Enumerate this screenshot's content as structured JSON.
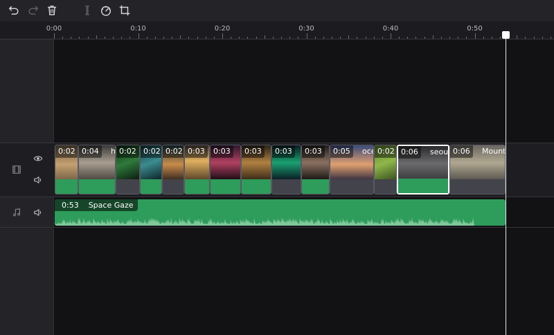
{
  "toolbar": {
    "tools": [
      {
        "name": "undo-icon",
        "enabled": true
      },
      {
        "name": "redo-icon",
        "enabled": false
      },
      {
        "name": "delete-icon",
        "enabled": true
      },
      {
        "name": "split-icon",
        "enabled": false
      },
      {
        "name": "speed-icon",
        "enabled": true
      },
      {
        "name": "crop-icon",
        "enabled": true
      }
    ]
  },
  "ruler": {
    "labels": [
      "0:00",
      "0:10",
      "0:20",
      "0:30",
      "0:40",
      "0:50"
    ]
  },
  "video_track": {
    "icons": [
      "film-icon",
      "eye-icon",
      "volume-icon"
    ],
    "clips": [
      {
        "dur": "0:02",
        "name": ""
      },
      {
        "dur": "0:04",
        "name": "h"
      },
      {
        "dur": "0:02",
        "name": ""
      },
      {
        "dur": "0:02",
        "name": ""
      },
      {
        "dur": "0:02",
        "name": ""
      },
      {
        "dur": "0:03",
        "name": ""
      },
      {
        "dur": "0:03",
        "name": ""
      },
      {
        "dur": "0:03",
        "name": ""
      },
      {
        "dur": "0:03",
        "name": ""
      },
      {
        "dur": "0:03",
        "name": ""
      },
      {
        "dur": "0:05",
        "name": "oce"
      },
      {
        "dur": "0:02",
        "name": ""
      },
      {
        "dur": "0:06",
        "name": "seoul"
      },
      {
        "dur": "0:06",
        "name": "Mount"
      }
    ]
  },
  "audio_track": {
    "icons": [
      "music-icon",
      "volume-icon"
    ],
    "clip": {
      "dur": "0:53",
      "name": "Space Gaze"
    }
  },
  "colors": {
    "audio_green": "#2e9c5a",
    "panel": "#242428",
    "timeline_bg": "#121214"
  }
}
